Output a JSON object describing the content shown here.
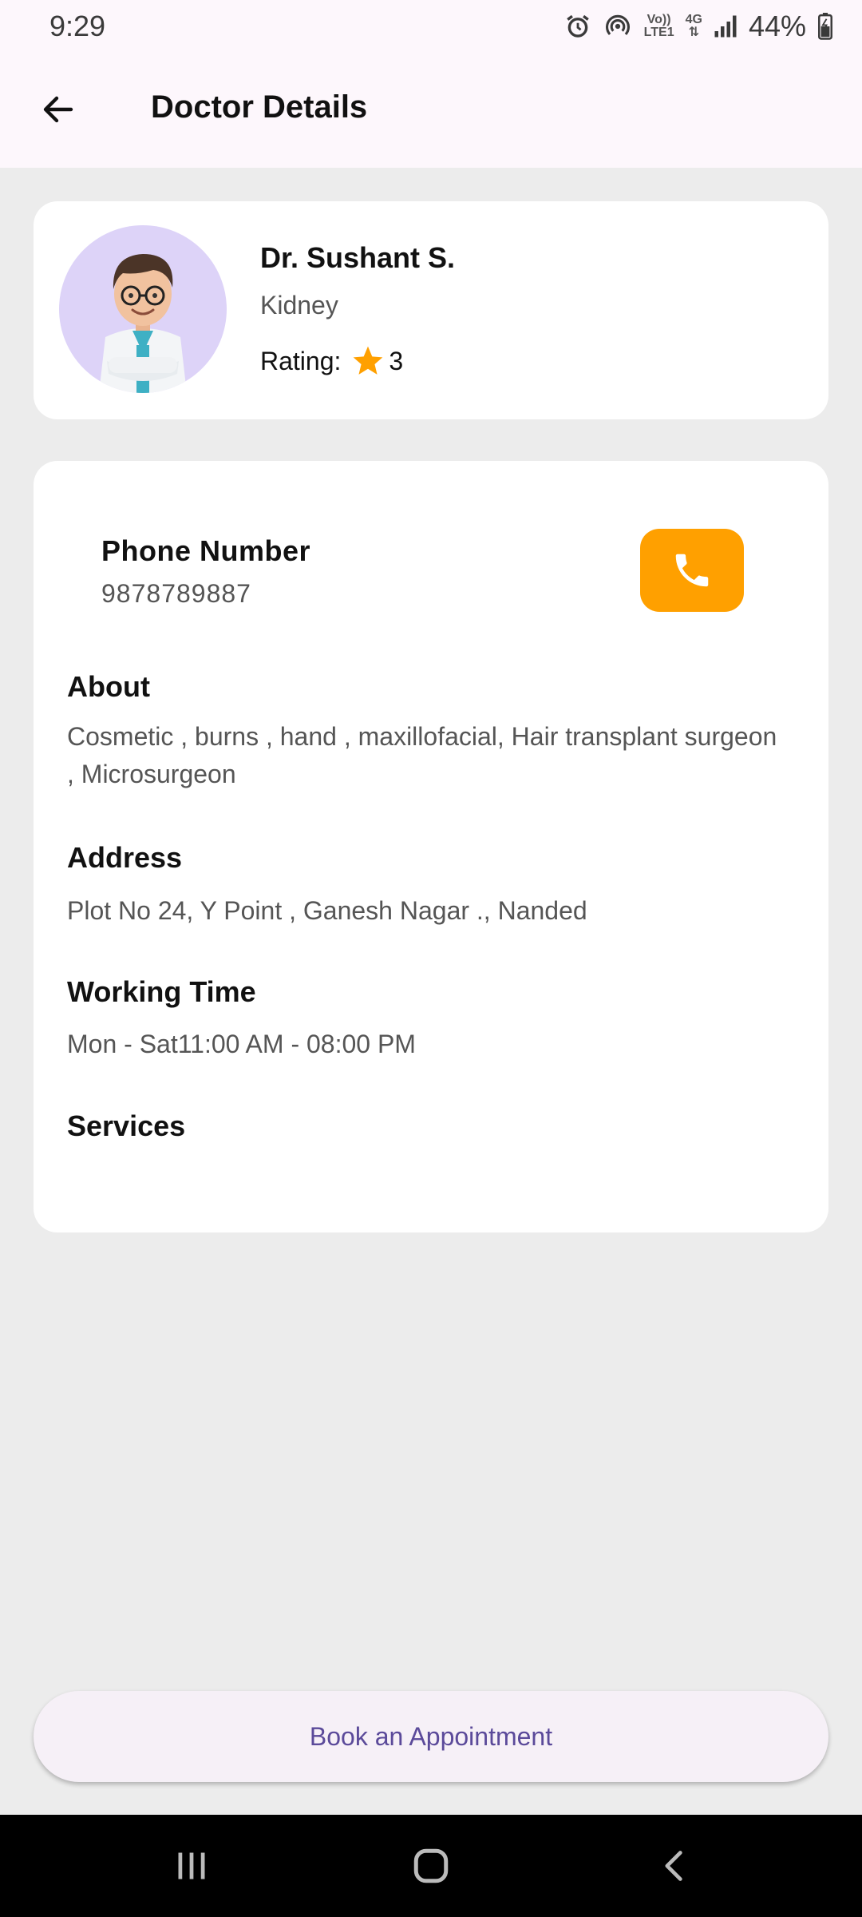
{
  "status_bar": {
    "time": "9:29",
    "net_top": "Vo))",
    "net_bottom": "LTE1",
    "gen": "4G",
    "battery": "44%",
    "icons": [
      "alarm-icon",
      "hotspot-icon",
      "signal-icon",
      "battery-icon"
    ]
  },
  "app_bar": {
    "title": "Doctor Details",
    "back_icon": "arrow-left-icon"
  },
  "doctor": {
    "name": "Dr. Sushant S.",
    "specialty": "Kidney",
    "rating_label": "Rating:",
    "rating_value": "3",
    "rating_icon": "star-icon"
  },
  "details": {
    "phone_label": "Phone Number",
    "phone_value": "9878789887",
    "about_title": "About",
    "about_text": "Cosmetic , burns , hand , maxillofacial, Hair transplant surgeon , Microsurgeon",
    "address_title": "Address",
    "address_text": "Plot No 24, Y Point , Ganesh Nagar ., Nanded",
    "working_title": "Working Time",
    "working_text": "Mon - Sat11:00 AM - 08:00 PM",
    "services_title": "Services"
  },
  "actions": {
    "book_label": "Book an Appointment"
  },
  "colors": {
    "accent_orange": "#ffa000",
    "star": "#ffa000",
    "button_text": "#5b4a9a",
    "avatar_bg": "#ddd3f8"
  }
}
